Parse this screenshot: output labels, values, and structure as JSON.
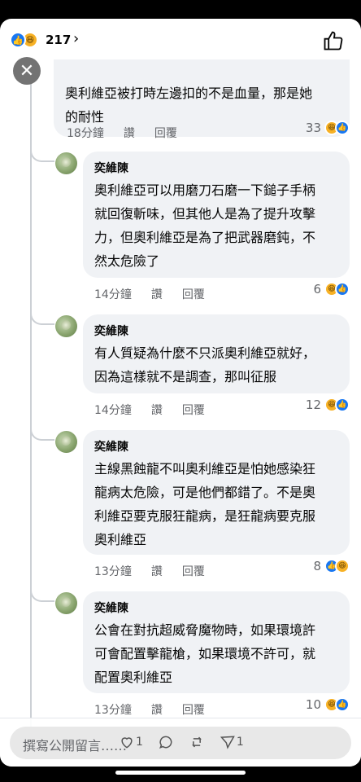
{
  "header": {
    "reaction_count": "217",
    "chevron": "›"
  },
  "top_comment": {
    "text": "奧利維亞被打時左邊扣的不是血量，那是她\n的耐性",
    "time": "18分鐘",
    "like_label": "讚",
    "reply_label": "回覆",
    "reaction_count": "33"
  },
  "replies": [
    {
      "author": "奕維陳",
      "text": "奧利維亞可以用磨刀石磨一下鎚子手柄\n就回復斬味，但其他人是為了提升攻擊\n力，但奧利維亞是為了把武器磨鈍，不\n然太危險了",
      "time": "14分鐘",
      "like_label": "讚",
      "reply_label": "回覆",
      "reaction_count": "6"
    },
    {
      "author": "奕維陳",
      "text": "有人質疑為什麼不只派奧利維亞就好，\n因為這樣就不是調查，那叫征服",
      "time": "14分鐘",
      "like_label": "讚",
      "reply_label": "回覆",
      "reaction_count": "12"
    },
    {
      "author": "奕維陳",
      "text": "主線黑蝕龍不叫奧利維亞是怕她感染狂\n龍病太危險，可是他們都錯了。不是奧\n利維亞要克服狂龍病，是狂龍病要克服\n奧利維亞",
      "time": "13分鐘",
      "like_label": "讚",
      "reply_label": "回覆",
      "reaction_count": "8"
    },
    {
      "author": "奕維陳",
      "text": "公會在對抗超威脅魔物時，如果環境許\n可會配置擊龍槍，如果環境不許可，就\n配置奧利維亞",
      "time": "13分鐘",
      "like_label": "讚",
      "reply_label": "回覆",
      "reaction_count": "10"
    }
  ],
  "composer": {
    "placeholder": "撰寫公開留言……",
    "like_count": "1",
    "share_count": "1"
  },
  "icons": {
    "like": "thumbs-up-icon",
    "haha": "haha-icon",
    "close": "close-icon",
    "heart": "heart-icon",
    "comment": "comment-icon",
    "repost": "repost-icon",
    "send": "send-icon"
  },
  "colors": {
    "like_blue": "#1877f2",
    "haha_yellow": "#f7b125",
    "bubble": "#f0f2f5",
    "meta": "#65676b"
  }
}
